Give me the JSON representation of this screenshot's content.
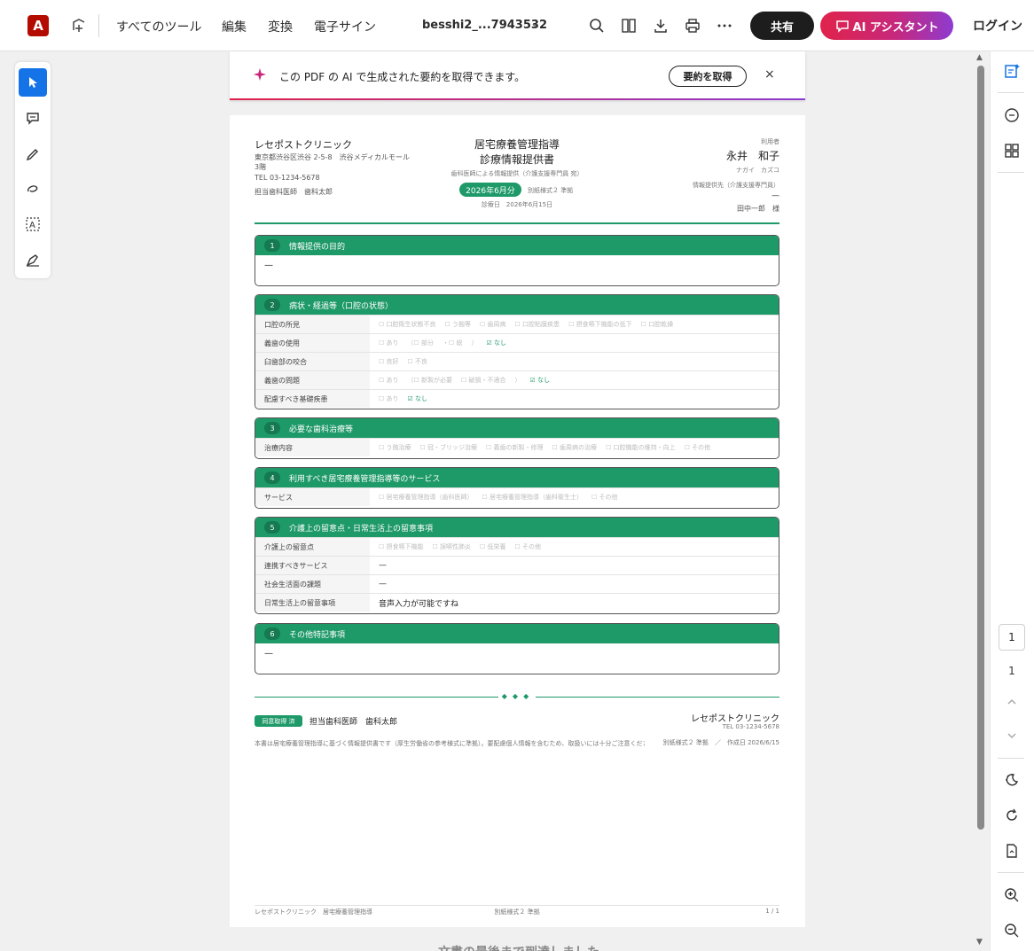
{
  "toolbar": {
    "menu": [
      "すべてのツール",
      "編集",
      "変換",
      "電子サイン"
    ],
    "file_name": "besshi2_...7943532",
    "share_label": "共有",
    "ai_label": "AI アシスタント",
    "login_label": "ログイン"
  },
  "banner": {
    "text": "この PDF の AI で生成された要約を取得できます。",
    "button": "要約を取得",
    "close": "×"
  },
  "pager": {
    "current": "1",
    "total": "1"
  },
  "doc": {
    "clinic_name": "レセポストクリニック",
    "clinic_address": "東京都渋谷区渋谷 2-5-8　渋谷メディカルモール",
    "clinic_floor": "3階",
    "clinic_tel": "TEL 03-1234-5678",
    "clinic_dentist": "担当歯科医師　歯科太郎",
    "title_line1": "居宅療養管理指導",
    "title_line2": "診療情報提供書",
    "subtitle": "歯科医師による情報提供（介護支援専門員 宛）",
    "date_pill": "2026年6月分",
    "form_note": "別紙様式２ 準拠",
    "visit_date": "診療日　2026年6月15日",
    "patient_label": "利用者",
    "patient_name": "永井　和子",
    "patient_kana": "ナガイ　カズコ",
    "recipient_label": "情報提供先（介護支援専門員）",
    "recipient_dash": "—",
    "recipient_name": "田中一郎　様",
    "sections": [
      {
        "num": "1",
        "title": "情報提供の目的",
        "body": "—"
      },
      {
        "num": "2",
        "title": "病状・経過等（口腔の状態）",
        "rows": [
          {
            "label": "口腔の所見",
            "items": [
              "☐ 口腔衛生状態不良",
              "☐ う蝕等",
              "☐ 歯周病",
              "☐ 口腔粘膜疾患",
              "☐ 摂食嚥下機能の低下",
              "☐ 口腔乾燥"
            ]
          },
          {
            "label": "義歯の使用",
            "items": [
              "☐ あり",
              "（☐ 部分",
              "・☐ 総",
              "）",
              "☑ なし"
            ]
          },
          {
            "label": "臼歯部の咬合",
            "items": [
              "☐ 良好",
              "☐ 不良"
            ]
          },
          {
            "label": "義歯の問題",
            "items": [
              "☐ あり",
              "（☐ 新製が必要",
              "☐ 破損・不適合",
              "）",
              "☑ なし"
            ]
          },
          {
            "label": "配慮すべき基礎疾患",
            "items": [
              "☐ あり",
              "☑ なし"
            ]
          }
        ]
      },
      {
        "num": "3",
        "title": "必要な歯科治療等",
        "rows": [
          {
            "label": "治療内容",
            "items": [
              "☐ う蝕治療",
              "☐ 冠・ブリッジ治療",
              "☐ 義歯の新製・修理",
              "☐ 歯周病の治療",
              "☐ 口腔機能の維持・向上",
              "☐ その他"
            ]
          }
        ]
      },
      {
        "num": "4",
        "title": "利用すべき居宅療養管理指導等のサービス",
        "rows": [
          {
            "label": "サービス",
            "items": [
              "☐ 居宅療養管理指導（歯科医師）",
              "☐ 居宅療養管理指導（歯科衛生士）",
              "☐ その他"
            ]
          }
        ]
      },
      {
        "num": "5",
        "title": "介護上の留意点・日常生活上の留意事項",
        "rows": [
          {
            "label": "介護上の留意点",
            "items": [
              "☐ 摂食嚥下機能",
              "☐ 誤嚥性肺炎",
              "☐ 低栄養",
              "☐ その他"
            ]
          },
          {
            "label": "連携すべきサービス",
            "value": "—"
          },
          {
            "label": "社会生活面の課題",
            "value": "—"
          },
          {
            "label": "日常生活上の留意事項",
            "value": "音声入力が可能ですね"
          }
        ]
      },
      {
        "num": "6",
        "title": "その他特記事項",
        "body": "—"
      }
    ],
    "consent_pill": "同意取得 済",
    "footer_dentist": "担当歯科医師　歯科太郎",
    "footer_clinic": "レセポストクリニック",
    "footer_tel": "TEL 03-1234-5678",
    "footer_note": "本書は居宅療養管理指導に基づく情報提供書です（厚生労働省の参考様式に準拠）。要配慮個人情報を含むため、取扱いには十分ご注意ください。",
    "footer_meta": "別紙様式２ 準拠　／　作成日 2026/6/15",
    "page_footer_left": "レセポストクリニック　居宅療養管理指導",
    "page_footer_center": "別紙様式２ 準拠",
    "page_footer_right": "1 / 1"
  },
  "below_page_text": "文書の最後まで到達しました",
  "colors": {
    "accent_green": "#1e9968",
    "brand_red": "#b30b00",
    "select_blue": "#1473e6"
  }
}
